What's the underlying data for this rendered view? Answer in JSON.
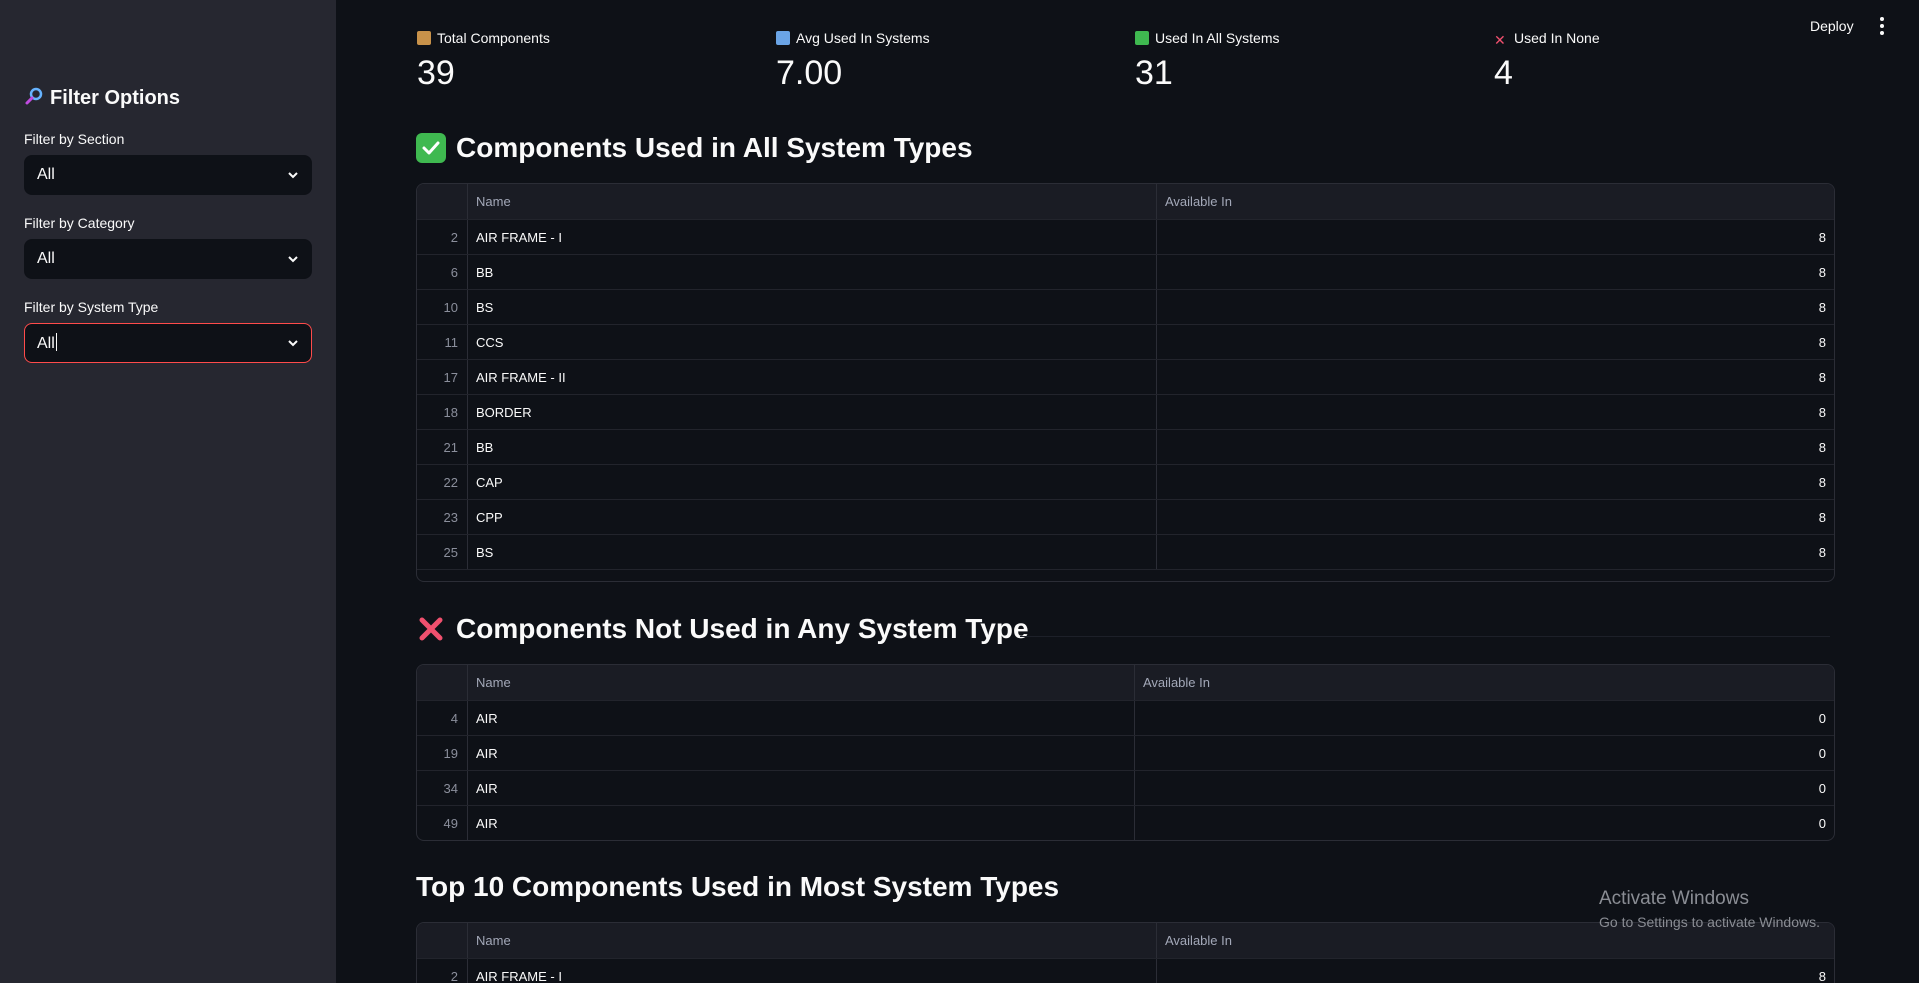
{
  "sidebar": {
    "title": "Filter Options",
    "filters": [
      {
        "label": "Filter by Section",
        "value": "All"
      },
      {
        "label": "Filter by Category",
        "value": "All"
      },
      {
        "label": "Filter by System Type",
        "value": "All"
      }
    ]
  },
  "header": {
    "deploy_label": "Deploy"
  },
  "metrics": [
    {
      "label": "Total Components",
      "value": "39",
      "icon": "package-icon"
    },
    {
      "label": "Avg Used In Systems",
      "value": "7.00",
      "icon": "bar-chart-icon"
    },
    {
      "label": "Used In All Systems",
      "value": "31",
      "icon": "check-icon"
    },
    {
      "label": "Used In None",
      "value": "4",
      "icon": "cross-icon"
    }
  ],
  "sections": {
    "all": {
      "title": "Components Used in All System Types"
    },
    "none": {
      "title": "Components Not Used in Any System Type"
    },
    "top": {
      "title": "Top 10 Components Used in Most System Types"
    }
  },
  "tables": {
    "columns": {
      "name": "Name",
      "available": "Available In"
    },
    "all_rows": [
      {
        "idx": "2",
        "name": "AIR FRAME - I",
        "available": "8"
      },
      {
        "idx": "6",
        "name": "BB",
        "available": "8"
      },
      {
        "idx": "10",
        "name": "BS",
        "available": "8"
      },
      {
        "idx": "11",
        "name": "CCS",
        "available": "8"
      },
      {
        "idx": "17",
        "name": "AIR FRAME - II",
        "available": "8"
      },
      {
        "idx": "18",
        "name": "BORDER",
        "available": "8"
      },
      {
        "idx": "21",
        "name": "BB",
        "available": "8"
      },
      {
        "idx": "22",
        "name": "CAP",
        "available": "8"
      },
      {
        "idx": "23",
        "name": "CPP",
        "available": "8"
      },
      {
        "idx": "25",
        "name": "BS",
        "available": "8"
      }
    ],
    "none_rows": [
      {
        "idx": "4",
        "name": "AIR",
        "available": "0"
      },
      {
        "idx": "19",
        "name": "AIR",
        "available": "0"
      },
      {
        "idx": "34",
        "name": "AIR",
        "available": "0"
      },
      {
        "idx": "49",
        "name": "AIR",
        "available": "0"
      }
    ],
    "top_rows": [
      {
        "idx": "2",
        "name": "AIR FRAME - I",
        "available": "8"
      }
    ]
  },
  "watermark": {
    "line1": "Activate Windows",
    "line2": "Go to Settings to activate Windows."
  }
}
